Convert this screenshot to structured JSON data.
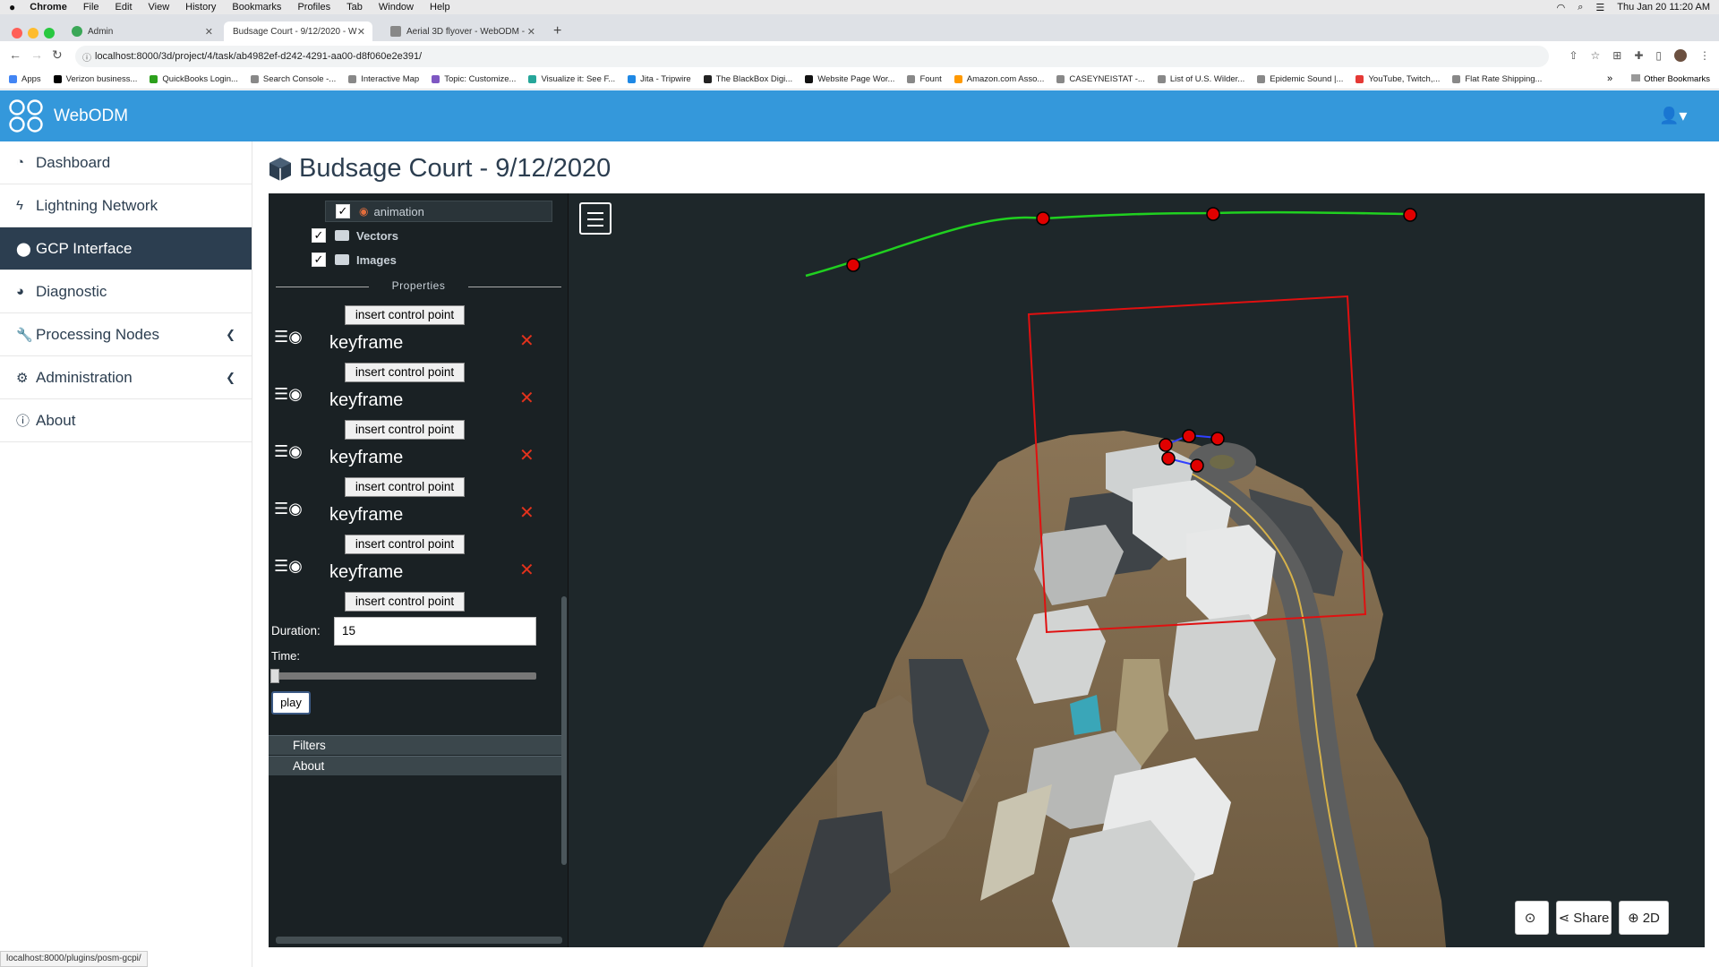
{
  "mac": {
    "apple": "",
    "app": "Chrome",
    "menus": [
      "File",
      "Edit",
      "View",
      "History",
      "Bookmarks",
      "Profiles",
      "Tab",
      "Window",
      "Help"
    ],
    "clock": "Thu Jan 20  11:20 AM"
  },
  "browser": {
    "tabs": [
      {
        "label": "Admin",
        "active": false
      },
      {
        "label": "Budsage Court - 9/12/2020 - W",
        "active": true
      },
      {
        "label": "Aerial 3D flyover - WebODM -",
        "active": false
      }
    ],
    "new_tab": "+",
    "url": "localhost:8000/3d/project/4/task/ab4982ef-d242-4291-aa00-d8f060e2e391/",
    "bookmarks": [
      "Apps",
      "Verizon business...",
      "QuickBooks Login...",
      "Search Console -...",
      "Interactive Map",
      "Topic: Customize...",
      "Visualize it: See F...",
      "Jita - Tripwire",
      "The BlackBox Digi...",
      "Website Page Wor...",
      "Fount",
      "Amazon.com Asso...",
      "CASEYNEISTAT -...",
      "List of U.S. Wilder...",
      "Epidemic Sound |...",
      "YouTube, Twitch,...",
      "Flat Rate Shipping..."
    ],
    "bookmarks_more": "»",
    "other_bookmarks": "Other Bookmarks"
  },
  "app": {
    "brand": "WebODM",
    "header_color": "#3498db",
    "sidebar": [
      {
        "label": "Dashboard",
        "icon": "dashboard-icon",
        "active": false
      },
      {
        "label": "Lightning Network",
        "icon": "bolt-icon",
        "active": false
      },
      {
        "label": "GCP Interface",
        "icon": "map-marker-icon",
        "active": true
      },
      {
        "label": "Diagnostic",
        "icon": "pie-chart-icon",
        "active": false
      },
      {
        "label": "Processing Nodes",
        "icon": "wrench-icon",
        "active": false,
        "chevron": true
      },
      {
        "label": "Administration",
        "icon": "cogs-icon",
        "active": false,
        "chevron": true
      },
      {
        "label": "About",
        "icon": "info-icon",
        "active": false
      }
    ],
    "page_title": "Budsage Court - 9/12/2020"
  },
  "viewer": {
    "tree": {
      "animation": "animation",
      "vectors": "Vectors",
      "images": "Images"
    },
    "properties_title": "Properties",
    "insert_label": "insert control point",
    "keyframes": [
      {
        "label": "keyframe"
      },
      {
        "label": "keyframe"
      },
      {
        "label": "keyframe"
      },
      {
        "label": "keyframe"
      },
      {
        "label": "keyframe"
      }
    ],
    "duration_label": "Duration:",
    "duration_value": "15",
    "time_label": "Time:",
    "time_fraction": 0,
    "play_label": "play",
    "sections": [
      "Filters",
      "About"
    ],
    "buttons": {
      "north": "",
      "share": "Share",
      "view2d": "2D"
    }
  },
  "status_url": "localhost:8000/plugins/posm-gcpi/",
  "colors": {
    "path_green": "#20d020",
    "keyframe_red": "#e00000",
    "frustum_red": "#e01010",
    "sidebar_active": "#2c3e50"
  }
}
